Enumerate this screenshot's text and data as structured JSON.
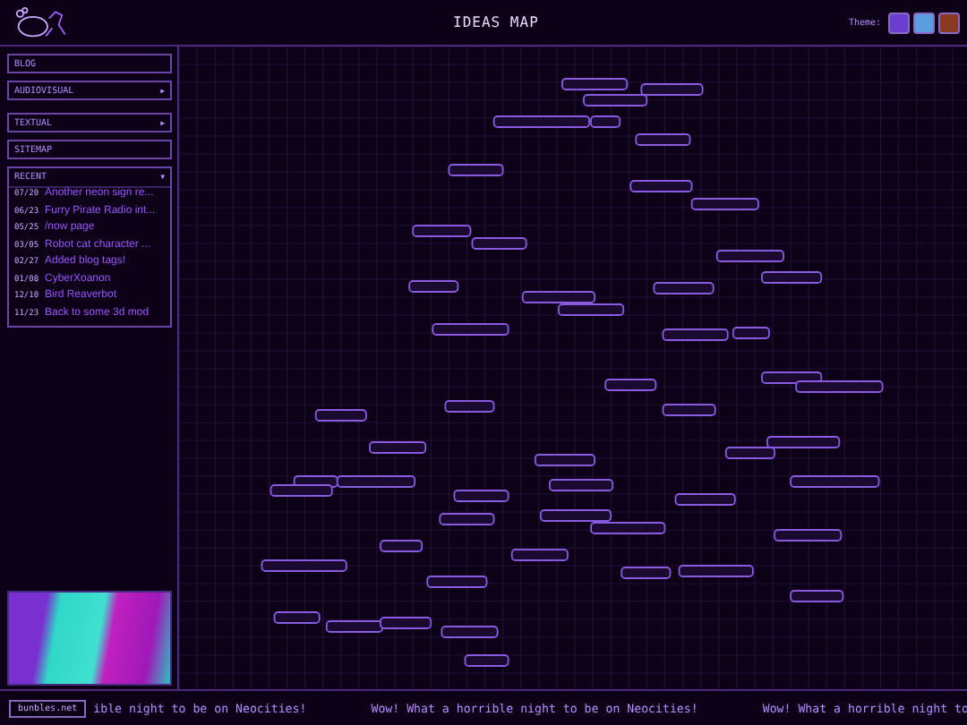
{
  "header": {
    "title": "IDEAS MAP",
    "theme_label": "Theme:",
    "themes": [
      {
        "color": "#6a3fd0"
      },
      {
        "color": "#5a9ee0"
      },
      {
        "color": "#8a3a22"
      }
    ]
  },
  "sidebar": {
    "nav": [
      {
        "label": "BLOG",
        "kind": "link"
      },
      {
        "label": "AUDIOVISUAL",
        "kind": "submenu",
        "arrow": "▶"
      },
      {
        "label": "TEXTUAL",
        "kind": "submenu",
        "arrow": "▶"
      },
      {
        "label": "SITEMAP",
        "kind": "link"
      }
    ],
    "recent": {
      "label": "RECENT",
      "arrow": "▼",
      "items": [
        {
          "date": "07/20",
          "title": "Another neon sign re..."
        },
        {
          "date": "06/23",
          "title": "Furry Pirate Radio int..."
        },
        {
          "date": "05/25",
          "title": "/now page"
        },
        {
          "date": "03/05",
          "title": "Robot cat character ..."
        },
        {
          "date": "02/27",
          "title": "Added blog tags!"
        },
        {
          "date": "01/08",
          "title": "CyberXoanon"
        },
        {
          "date": "12/10",
          "title": "Bird Reaverbot"
        },
        {
          "date": "11/23",
          "title": "Back to some 3d mod"
        }
      ]
    }
  },
  "footer": {
    "badge": "bunbles.net",
    "marquee": [
      "ible night to be on Neocities!",
      "Wow! What a horrible night to be on Neocities!",
      "Wow! What a horrible night to"
    ]
  }
}
